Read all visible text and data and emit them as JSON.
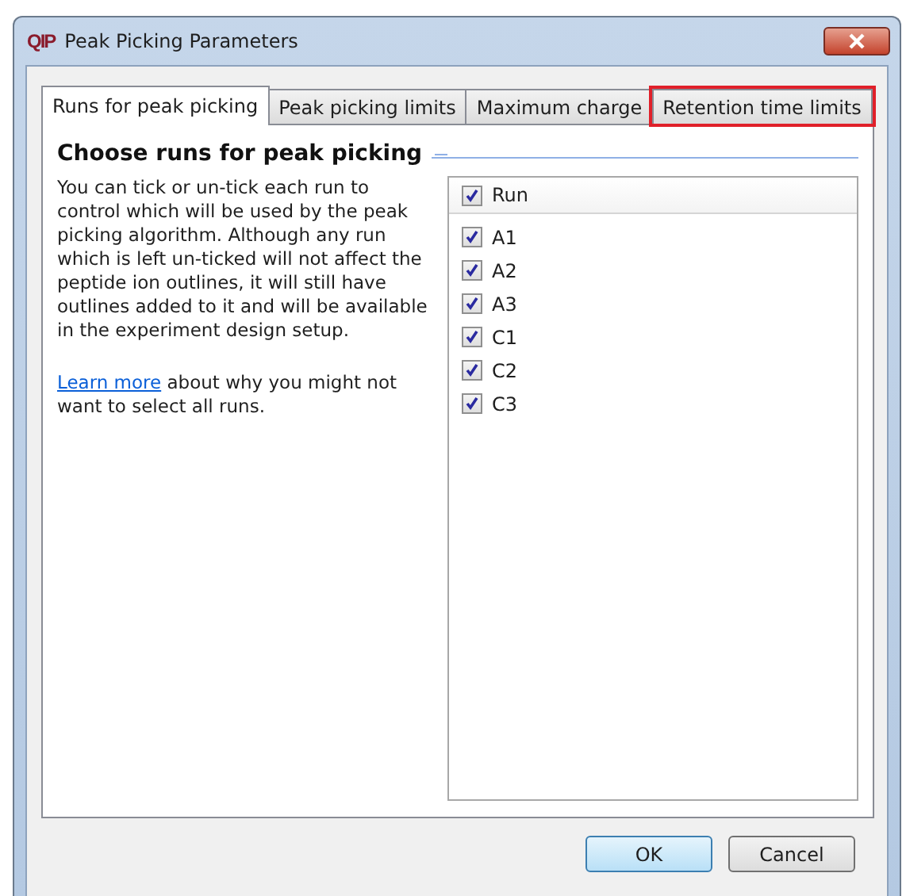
{
  "window": {
    "logo": "QIP",
    "title": "Peak Picking Parameters"
  },
  "tabs": [
    {
      "label": "Runs for peak picking",
      "selected": true,
      "highlighted": false
    },
    {
      "label": "Peak picking limits",
      "selected": false,
      "highlighted": false
    },
    {
      "label": "Maximum charge",
      "selected": false,
      "highlighted": false
    },
    {
      "label": "Retention time limits",
      "selected": false,
      "highlighted": true
    }
  ],
  "heading": "Choose runs for peak picking",
  "description": "You can tick or un-tick each run to control which will be used by the peak picking algorithm. Although any run which is left un-ticked will not affect the peptide ion outlines, it will still have outlines added to it and will be available in the experiment design setup.",
  "learn_more": {
    "link": "Learn more",
    "text": " about why you might not want to select all runs."
  },
  "runs_list": {
    "header": {
      "label": "Run",
      "checked": true
    },
    "items": [
      {
        "label": "A1",
        "checked": true
      },
      {
        "label": "A2",
        "checked": true
      },
      {
        "label": "A3",
        "checked": true
      },
      {
        "label": "C1",
        "checked": true
      },
      {
        "label": "C2",
        "checked": true
      },
      {
        "label": "C3",
        "checked": true
      }
    ]
  },
  "buttons": [
    {
      "label": "OK",
      "default": true
    },
    {
      "label": "Cancel",
      "default": false
    }
  ]
}
